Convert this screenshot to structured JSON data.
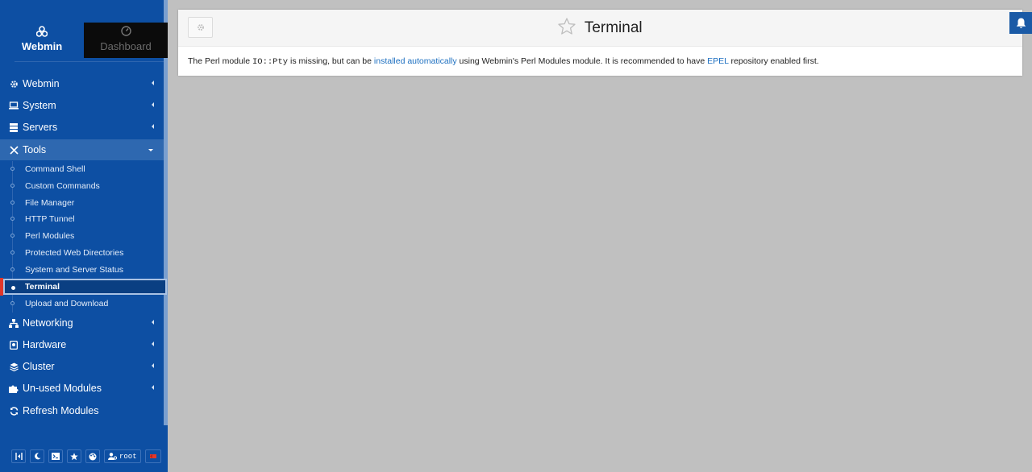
{
  "sidebar": {
    "switch": {
      "webmin_label": "Webmin",
      "dashboard_label": "Dashboard"
    },
    "menu": {
      "webmin": "Webmin",
      "system": "System",
      "servers": "Servers",
      "tools": "Tools",
      "networking": "Networking",
      "hardware": "Hardware",
      "cluster": "Cluster",
      "unused": "Un-used Modules",
      "refresh": "Refresh Modules"
    },
    "tools_items": [
      "Command Shell",
      "Custom Commands",
      "File Manager",
      "HTTP Tunnel",
      "Perl Modules",
      "Protected Web Directories",
      "System and Server Status",
      "Terminal",
      "Upload and Download"
    ],
    "bottom": {
      "user": "root"
    }
  },
  "main": {
    "title": "Terminal",
    "message": {
      "p1": "The Perl module ",
      "code": "IO::Pty",
      "p2": " is missing, but can be ",
      "link1": "installed automatically",
      "p3": " using Webmin's Perl Modules module. It is recommended to have ",
      "link2": "EPEL",
      "p4": " repository enabled first."
    }
  },
  "colors": {
    "sidebar": "#0d4fa3",
    "active_item": "#2e68b0",
    "link": "#1c6fc0",
    "current_marker": "#e1372a"
  }
}
